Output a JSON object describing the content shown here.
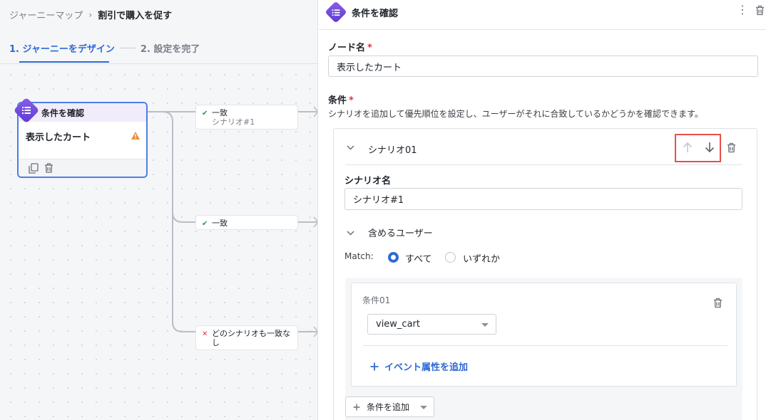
{
  "breadcrumb": {
    "root": "ジャーニーマップ",
    "separator": "›",
    "current": "割引で購入を促す"
  },
  "steps": [
    {
      "label": "1. ジャーニーをデザイン",
      "active": true
    },
    {
      "label": "2. 設定を完了",
      "active": false
    }
  ],
  "node": {
    "type_label": "条件を確認",
    "name": "表示したカート",
    "icon": "list-icon",
    "warning_icon": "warning-icon"
  },
  "branches": [
    {
      "status": "match",
      "label": "一致",
      "sublabel": "シナリオ#1"
    },
    {
      "status": "match",
      "label": "一致",
      "sublabel": ""
    },
    {
      "status": "no-match",
      "label": "どのシナリオも一致なし"
    }
  ],
  "panel": {
    "title": "条件を確認",
    "node_name_label": "ノード名",
    "node_name_value": "表示したカート",
    "conditions_label": "条件",
    "conditions_desc": "シナリオを追加して優先順位を設定し、ユーザーがそれに合致しているかどうかを確認できます。",
    "required_mark": "*"
  },
  "scenario": {
    "title": "シナリオ01",
    "name_label": "シナリオ名",
    "name_value": "シナリオ#1",
    "include_users_label": "含めるユーザー",
    "match_label": "Match:",
    "match_options": [
      {
        "label": "すべて",
        "selected": true
      },
      {
        "label": "いずれか",
        "selected": false
      }
    ],
    "condition": {
      "title": "条件01",
      "event_selected": "view_cart",
      "add_attribute_label": "イベント属性を追加"
    },
    "add_condition_label": "条件を追加"
  },
  "colors": {
    "accent": "#2e6ad6",
    "node_purple": "#6a45d9",
    "highlight_red": "#e5504a",
    "match_green": "#1a9b55",
    "nomatch_red": "#e0334c"
  }
}
